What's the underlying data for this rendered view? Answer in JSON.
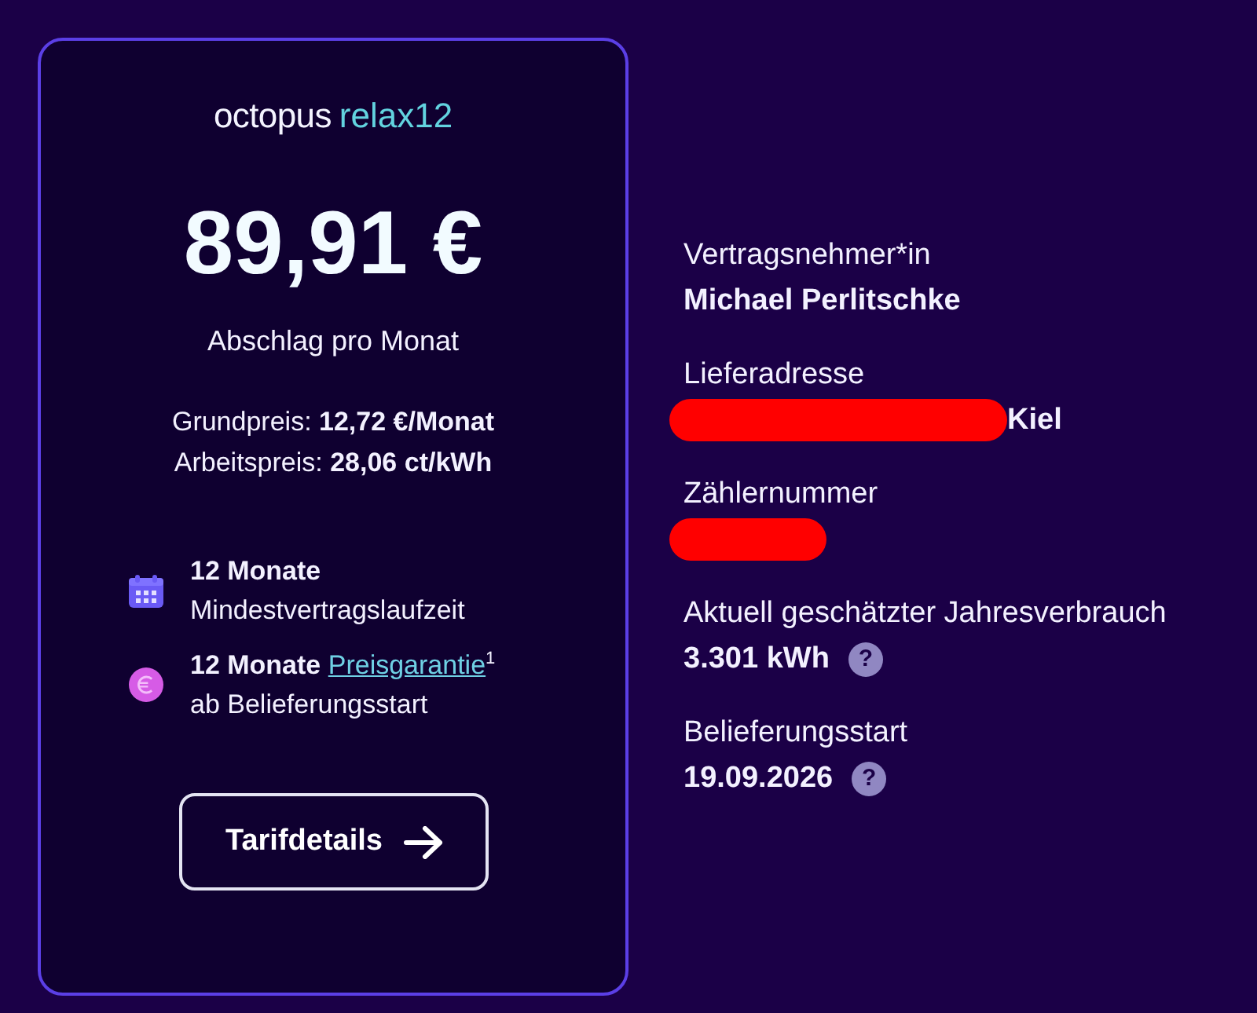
{
  "card": {
    "logo": {
      "brand": "octopus",
      "product": "relax12"
    },
    "price": "89,91 €",
    "price_caption": "Abschlag pro Monat",
    "price_lines": [
      {
        "label": "Grundpreis:",
        "value": "12,72 €/Monat"
      },
      {
        "label": "Arbeitspreis:",
        "value": "28,06 ct/kWh"
      }
    ],
    "features": [
      {
        "kind": "calendar",
        "title": "12 Monate",
        "subtitle": "Mindestvertragslaufzeit"
      },
      {
        "kind": "euro",
        "title": "12 Monate",
        "link": "Preisgarantie",
        "footnote": "1",
        "subtitle": "ab Belieferungsstart"
      }
    ],
    "button": {
      "label": "Tarifdetails"
    }
  },
  "details": [
    {
      "label": "Vertragsnehmer*in",
      "value": "Michael Perlitschke",
      "redacted": false
    },
    {
      "label": "Lieferadresse",
      "value": "Kiel",
      "redacted": true
    },
    {
      "label": "Zählernummer",
      "redacted": true
    },
    {
      "label": "Aktuell geschätzter Jahresverbrauch",
      "value": "3.301 kWh",
      "redacted": false,
      "help": "?"
    },
    {
      "label": "Belieferungsstart",
      "value": "19.09.2026",
      "redacted": false,
      "help": "?"
    }
  ]
}
